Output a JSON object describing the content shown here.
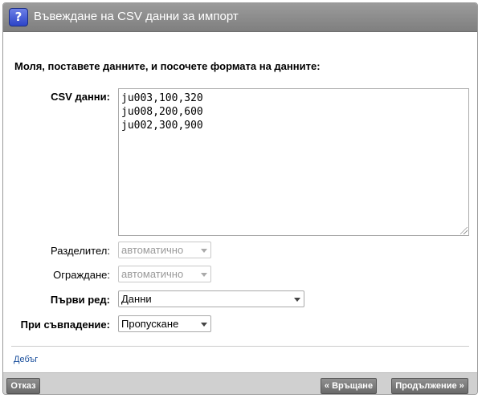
{
  "window": {
    "title": "Въвеждане на CSV данни за импорт",
    "icon": "help-icon"
  },
  "form": {
    "instructions": "Моля, поставете данните, и посочете формата на данните:",
    "csv_label": "CSV данни",
    "csv_value": "ju003,100,320\nju008,200,600\nju002,300,900",
    "separator_label": "Разделител:",
    "separator_value": "автоматично",
    "enclosure_label": "Ограждане:",
    "enclosure_value": "автоматично",
    "first_row_label": "Първи ред",
    "first_row_value": "Данни",
    "on_match_label": "При съвпадение",
    "on_match_value": "Пропускане"
  },
  "debug_link": "Дебъг",
  "footer": {
    "cancel_label": "Отказ",
    "back_label": "« Връщане",
    "continue_label": "Продължение »"
  }
}
